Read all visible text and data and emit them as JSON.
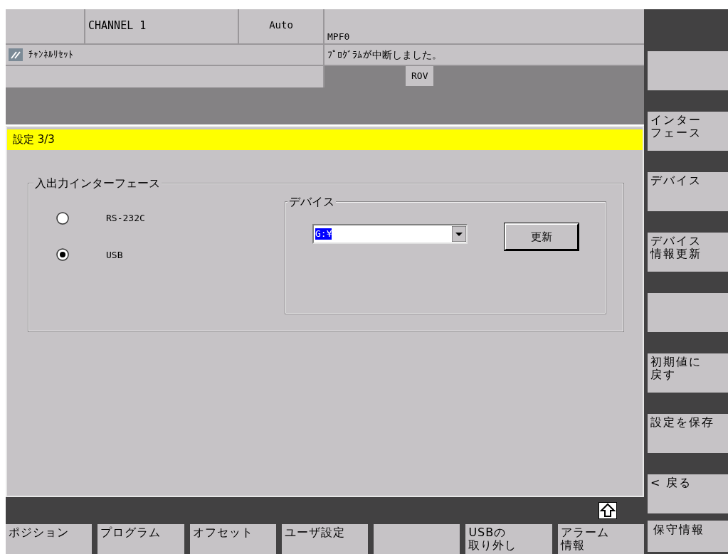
{
  "header": {
    "channel": "CHANNEL 1",
    "mode": "Auto",
    "program": "MPF0",
    "reset_status": "ﾁｬﾝﾈﾙﾘｾｯﾄ",
    "message": "ﾌﾟﾛｸﾞﾗﾑが中断しました。",
    "badge": "ROV"
  },
  "panel": {
    "title": "設定 3/3",
    "interface_group": {
      "title": "入出力インターフェース",
      "options": [
        {
          "label": "RS-232C",
          "selected": false
        },
        {
          "label": "USB",
          "selected": true
        }
      ]
    },
    "device_group": {
      "title": "デバイス",
      "dropdown": {
        "value": "G:¥"
      },
      "button": "更新"
    }
  },
  "right_softkeys": [
    {
      "kind": "blank"
    },
    {
      "kind": "key",
      "lines": [
        "インター",
        "フェース"
      ]
    },
    {
      "kind": "key",
      "lines": [
        "デバイス"
      ]
    },
    {
      "kind": "key",
      "lines": [
        "デバイス",
        "情報更新"
      ]
    },
    {
      "kind": "blank"
    },
    {
      "kind": "key",
      "lines": [
        "初期値に",
        "戻す"
      ]
    },
    {
      "kind": "key",
      "lines": [
        "設定を保存"
      ]
    },
    {
      "kind": "key",
      "lines": [
        "< 戻る"
      ]
    },
    {
      "kind": "key",
      "lines": [
        "保守情報"
      ]
    }
  ],
  "bottom_softkeys": [
    {
      "kind": "key",
      "lines": [
        "ポジション"
      ]
    },
    {
      "kind": "key",
      "lines": [
        "プログラム"
      ]
    },
    {
      "kind": "key",
      "lines": [
        "オフセット"
      ]
    },
    {
      "kind": "key",
      "lines": [
        "ユーザ設定"
      ]
    },
    {
      "kind": "blank"
    },
    {
      "kind": "key",
      "lines": [
        "USBの",
        "取り外し"
      ]
    },
    {
      "kind": "key",
      "lines": [
        "アラーム",
        "情報"
      ]
    }
  ]
}
